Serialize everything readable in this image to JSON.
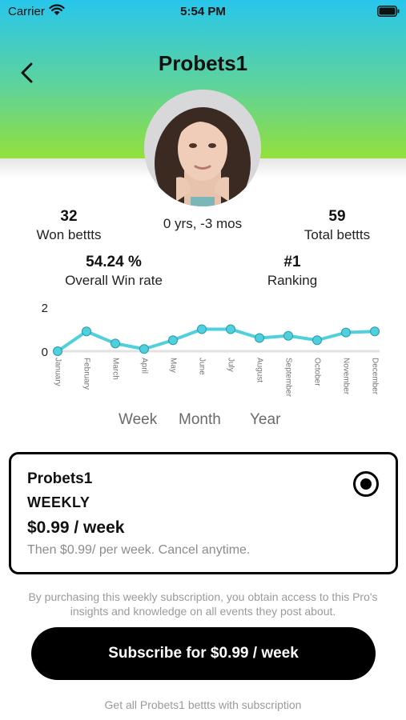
{
  "status_bar": {
    "carrier": "Carrier",
    "time": "5:54 PM"
  },
  "header": {
    "title": "Probets1",
    "back_icon": "chevron-left-icon",
    "gradient_colors": [
      "#28c6ec",
      "#93e03b"
    ]
  },
  "profile": {
    "age": "0 yrs, -3 mos"
  },
  "stats": {
    "won": {
      "value": "32",
      "label": "Won bettts"
    },
    "total": {
      "value": "59",
      "label": "Total bettts"
    },
    "win_rate": {
      "value": "54.24 %",
      "label": "Overall Win rate"
    },
    "ranking": {
      "value": "#1",
      "label": "Ranking"
    }
  },
  "chart_data": {
    "type": "line",
    "categories": [
      "January",
      "February",
      "March",
      "April",
      "May",
      "June",
      "July",
      "August",
      "September",
      "October",
      "November",
      "December"
    ],
    "values": [
      0,
      0.9,
      0.35,
      0.1,
      0.5,
      1.0,
      1.0,
      0.6,
      0.7,
      0.5,
      0.85,
      0.9
    ],
    "ylim": [
      0,
      2
    ],
    "y_ticks": [
      "0",
      "2"
    ],
    "line_color": "#4fd0dc",
    "grid": false
  },
  "period_tabs": [
    "Week",
    "Month",
    "Year"
  ],
  "plan": {
    "name": "Probets1",
    "period": "WEEKLY",
    "price": "$0.99 / week",
    "note": "Then $0.99/ per week. Cancel anytime.",
    "selected": true
  },
  "disclaimer": "By purchasing this weekly subscription, you obtain access to this Pro's insights and knowledge on all events they post about.",
  "subscribe_button": "Subscribe for $0.99 / week",
  "footer_note": "Get all Probets1 bettts with subscription"
}
